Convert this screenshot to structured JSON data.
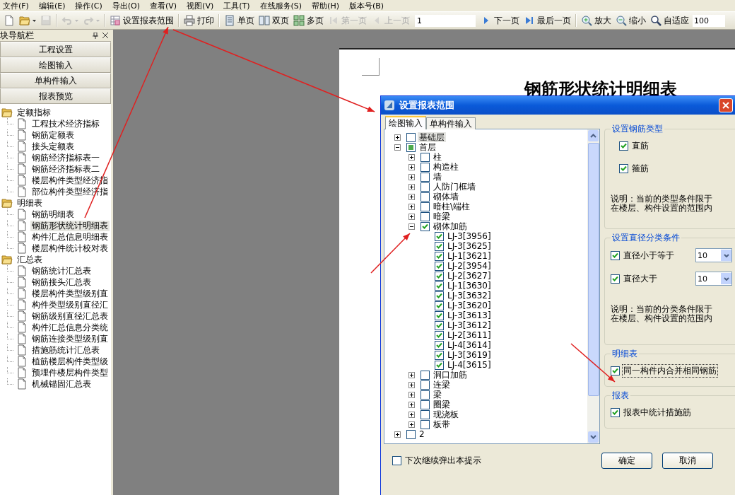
{
  "menu": [
    "文件(F)",
    "编辑(E)",
    "操作(C)",
    "导出(O)",
    "查看(V)",
    "视图(V)",
    "工具(T)",
    "在线服务(S)",
    "帮助(H)",
    "版本号(B)"
  ],
  "toolbar": [
    {
      "kind": "icon",
      "disabled": false,
      "dropdown": false
    },
    {
      "kind": "icon",
      "disabled": false,
      "dropdown": true
    },
    {
      "kind": "icon",
      "disabled": true,
      "dropdown": false
    },
    {
      "kind": "sep"
    },
    {
      "kind": "icon",
      "disabled": true,
      "dropdown": true
    },
    {
      "kind": "icon",
      "disabled": true,
      "dropdown": true
    },
    {
      "kind": "sep"
    },
    {
      "kind": "button",
      "label": "设置报表范围",
      "disabled": false
    },
    {
      "kind": "sep"
    },
    {
      "kind": "button",
      "label": "打印",
      "disabled": false
    },
    {
      "kind": "sep"
    },
    {
      "kind": "button",
      "label": "单页",
      "disabled": false
    },
    {
      "kind": "button",
      "label": "双页",
      "disabled": false
    },
    {
      "kind": "button",
      "label": "多页",
      "disabled": false
    },
    {
      "kind": "button",
      "label": "第一页",
      "disabled": true
    },
    {
      "kind": "button",
      "label": "上一页",
      "disabled": true
    },
    {
      "kind": "field",
      "value": "1"
    },
    {
      "kind": "button",
      "label": "下一页",
      "disabled": false
    },
    {
      "kind": "button",
      "label": "最后一页",
      "disabled": false
    },
    {
      "kind": "sep"
    },
    {
      "kind": "button",
      "label": "放大",
      "disabled": false
    },
    {
      "kind": "button",
      "label": "缩小",
      "disabled": false
    },
    {
      "kind": "button",
      "label": "自适应",
      "disabled": false
    },
    {
      "kind": "combo",
      "value": "100"
    }
  ],
  "nav": {
    "title": "块导航栏",
    "buttons": [
      "工程设置",
      "绘图输入",
      "单构件输入",
      "报表预览"
    ]
  },
  "report_tree": [
    {
      "label": "定额指标",
      "children": [
        {
          "label": "工程技术经济指标",
          "selected": false
        },
        {
          "label": "钢筋定额表",
          "selected": false
        },
        {
          "label": "接头定额表",
          "selected": false
        },
        {
          "label": "钢筋经济指标表一",
          "selected": false
        },
        {
          "label": "钢筋经济指标表二",
          "selected": false
        },
        {
          "label": "楼层构件类型经济指",
          "selected": false
        },
        {
          "label": "部位构件类型经济指",
          "selected": false
        }
      ]
    },
    {
      "label": "明细表",
      "children": [
        {
          "label": "钢筋明细表",
          "selected": false
        },
        {
          "label": "钢筋形状统计明细表",
          "selected": true
        },
        {
          "label": "构件汇总信息明细表",
          "selected": false
        },
        {
          "label": "楼层构件统计校对表",
          "selected": false
        }
      ]
    },
    {
      "label": "汇总表",
      "children": [
        {
          "label": "钢筋统计汇总表",
          "selected": false
        },
        {
          "label": "钢筋接头汇总表",
          "selected": false
        },
        {
          "label": "楼层构件类型级别直",
          "selected": false
        },
        {
          "label": "构件类型级别直径汇",
          "selected": false
        },
        {
          "label": "钢筋级别直径汇总表",
          "selected": false
        },
        {
          "label": "构件汇总信息分类统",
          "selected": false
        },
        {
          "label": "钢筋连接类型级别直",
          "selected": false
        },
        {
          "label": "措施筋统计汇总表",
          "selected": false
        },
        {
          "label": "植筋楼层构件类型级",
          "selected": false
        },
        {
          "label": "预埋件楼层构件类型",
          "selected": false
        },
        {
          "label": "机械锚固汇总表",
          "selected": false
        }
      ]
    }
  ],
  "document": {
    "title": "钢筋形状统计明细表"
  },
  "dialog": {
    "title": "设置报表范围",
    "tabs": [
      {
        "label": "绘图输入",
        "selected": true
      },
      {
        "label": "单构件输入",
        "selected": false
      }
    ],
    "tree": [
      {
        "label": "基础层",
        "checked": false,
        "partial": false,
        "expanded": false,
        "selected": true
      },
      {
        "label": "首层",
        "checked": false,
        "partial": true,
        "expanded": true,
        "selected": false,
        "children": [
          {
            "label": "柱",
            "checked": false,
            "partial": false,
            "expanded": false,
            "selected": false
          },
          {
            "label": "构造柱",
            "checked": false,
            "partial": false,
            "expanded": false,
            "selected": false
          },
          {
            "label": "墙",
            "checked": false,
            "partial": false,
            "expanded": false,
            "selected": false
          },
          {
            "label": "人防门框墙",
            "checked": false,
            "partial": false,
            "expanded": false,
            "selected": false
          },
          {
            "label": "砌体墙",
            "checked": false,
            "partial": false,
            "expanded": false,
            "selected": false
          },
          {
            "label": "暗柱\\端柱",
            "checked": false,
            "partial": false,
            "expanded": false,
            "selected": false
          },
          {
            "label": "暗梁",
            "checked": false,
            "partial": false,
            "expanded": false,
            "selected": false
          },
          {
            "label": "砌体加筋",
            "checked": true,
            "partial": false,
            "expanded": true,
            "selected": false,
            "children": [
              {
                "label": "LJ-3[3956]",
                "checked": true,
                "partial": false,
                "selected": false
              },
              {
                "label": "LJ-3[3625]",
                "checked": true,
                "partial": false,
                "selected": false
              },
              {
                "label": "LJ-1[3621]",
                "checked": true,
                "partial": false,
                "selected": false
              },
              {
                "label": "LJ-2[3954]",
                "checked": true,
                "partial": false,
                "selected": false
              },
              {
                "label": "LJ-2[3627]",
                "checked": true,
                "partial": false,
                "selected": false
              },
              {
                "label": "LJ-1[3630]",
                "checked": true,
                "partial": false,
                "selected": false
              },
              {
                "label": "LJ-3[3632]",
                "checked": true,
                "partial": false,
                "selected": false
              },
              {
                "label": "LJ-3[3620]",
                "checked": true,
                "partial": false,
                "selected": false
              },
              {
                "label": "LJ-3[3613]",
                "checked": true,
                "partial": false,
                "selected": false
              },
              {
                "label": "LJ-3[3612]",
                "checked": true,
                "partial": false,
                "selected": false
              },
              {
                "label": "LJ-2[3611]",
                "checked": true,
                "partial": false,
                "selected": false
              },
              {
                "label": "LJ-4[3614]",
                "checked": true,
                "partial": false,
                "selected": false
              },
              {
                "label": "LJ-3[3619]",
                "checked": true,
                "partial": false,
                "selected": false
              },
              {
                "label": "LJ-4[3615]",
                "checked": true,
                "partial": false,
                "selected": false
              }
            ]
          },
          {
            "label": "洞口加筋",
            "checked": false,
            "partial": false,
            "expanded": false,
            "selected": false
          },
          {
            "label": "连梁",
            "checked": false,
            "partial": false,
            "expanded": false,
            "selected": false
          },
          {
            "label": "梁",
            "checked": false,
            "partial": false,
            "expanded": false,
            "selected": false
          },
          {
            "label": "圈梁",
            "checked": false,
            "partial": false,
            "expanded": false,
            "selected": false
          },
          {
            "label": "现浇板",
            "checked": false,
            "partial": false,
            "expanded": false,
            "selected": false
          },
          {
            "label": "板带",
            "checked": false,
            "partial": false,
            "expanded": false,
            "selected": false
          }
        ]
      },
      {
        "label": "2",
        "checked": false,
        "partial": false,
        "expanded": false,
        "selected": false
      }
    ],
    "groups": [
      {
        "title": "设置钢筋类型",
        "rows": [
          {
            "kind": "check",
            "label": "直筋",
            "checked": true,
            "focused": false
          },
          {
            "kind": "check",
            "label": "箍筋",
            "checked": true,
            "focused": false
          },
          {
            "kind": "note",
            "text": "说明：当前的类型条件限于在楼层、构件设置的范围内"
          }
        ]
      },
      {
        "title": "设置直径分类条件",
        "rows": [
          {
            "kind": "check-combo",
            "label": "直径小于等于",
            "checked": true,
            "focused": false,
            "value": "10"
          },
          {
            "kind": "check-combo",
            "label": "直径大于",
            "checked": true,
            "focused": false,
            "value": "10"
          },
          {
            "kind": "note",
            "text": "说明：当前的分类条件限于在楼层、构件设置的范围内"
          }
        ]
      },
      {
        "title": "明细表",
        "rows": [
          {
            "kind": "check",
            "label": "同一构件内合并相同钢筋",
            "checked": true,
            "focused": true
          }
        ]
      },
      {
        "title": "报表",
        "rows": [
          {
            "kind": "check",
            "label": "报表中统计措施筋",
            "checked": true,
            "focused": false
          }
        ]
      }
    ],
    "footer": {
      "checkbox": {
        "label": "下次继续弹出本提示",
        "checked": false
      },
      "buttons": [
        "确定",
        "取消"
      ]
    }
  }
}
